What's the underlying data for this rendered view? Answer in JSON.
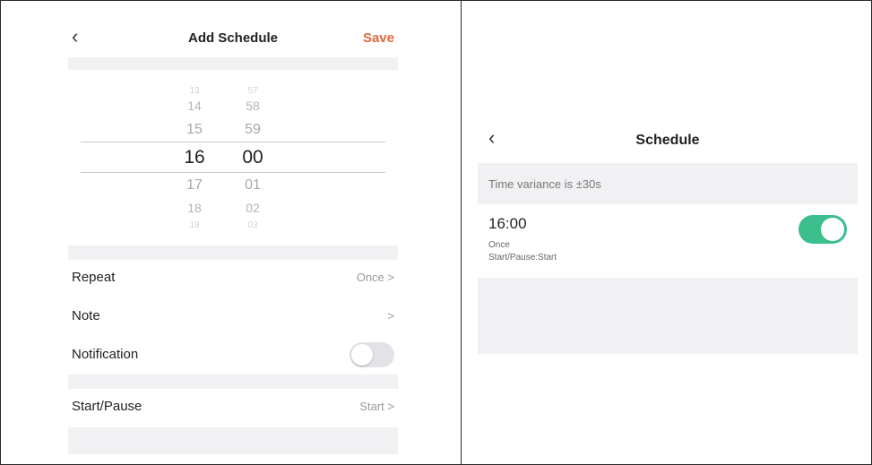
{
  "add_schedule": {
    "title": "Add Schedule",
    "back_icon": "chevron-left-icon",
    "save_label": "Save",
    "accent_color": "#e0683c",
    "picker": {
      "hours": [
        "13",
        "14",
        "15",
        "16",
        "17",
        "18",
        "19"
      ],
      "minutes": [
        "57",
        "58",
        "59",
        "00",
        "01",
        "02",
        "03"
      ],
      "selected_hour": "16",
      "selected_minute": "00"
    },
    "rows": {
      "repeat": {
        "label": "Repeat",
        "value": "Once >"
      },
      "note": {
        "label": "Note",
        "value": ">"
      },
      "notification": {
        "label": "Notification",
        "enabled": false
      },
      "start_pause": {
        "label": "Start/Pause",
        "value": "Start >"
      }
    }
  },
  "schedule": {
    "title": "Schedule",
    "back_icon": "chevron-left-icon",
    "variance_text": "Time variance is  ±30s",
    "items": [
      {
        "time": "16:00",
        "repeat": "Once",
        "action": "Start/Pause:Start",
        "enabled": true
      }
    ],
    "toggle_on_color": "#3cbe8d"
  }
}
